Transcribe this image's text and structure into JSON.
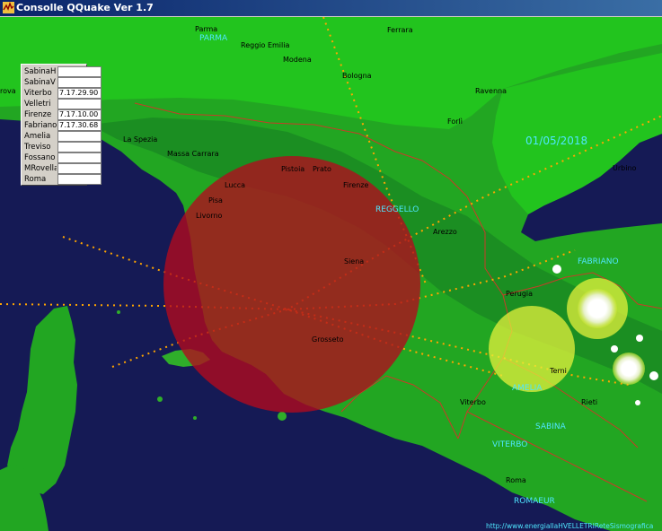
{
  "window": {
    "title": "Consolle QQuake Ver 1.7",
    "title_icon": "qquake-app-icon"
  },
  "map": {
    "date": "01/05/2018",
    "url_text": "http://www.energiallaHVELLETRIReteSismografica",
    "cities": [
      {
        "name": "Parma",
        "style": "black"
      },
      {
        "name": "PARMA",
        "style": "cyan"
      },
      {
        "name": "Reggio Emilia",
        "style": "black"
      },
      {
        "name": "Modena",
        "style": "black"
      },
      {
        "name": "Ferrara",
        "style": "black"
      },
      {
        "name": "Bologna",
        "style": "black"
      },
      {
        "name": "Ravenna",
        "style": "black"
      },
      {
        "name": "Forlì",
        "style": "black"
      },
      {
        "name": "La Spezia",
        "style": "black"
      },
      {
        "name": "Massa Carrara",
        "style": "black"
      },
      {
        "name": "Pistoia",
        "style": "black"
      },
      {
        "name": "Prato",
        "style": "black"
      },
      {
        "name": "Lucca",
        "style": "black"
      },
      {
        "name": "Firenze",
        "style": "black"
      },
      {
        "name": "Pisa",
        "style": "black"
      },
      {
        "name": "Livorno",
        "style": "black"
      },
      {
        "name": "REGGELLO",
        "style": "cyan"
      },
      {
        "name": "Arezzo",
        "style": "black"
      },
      {
        "name": "Siena",
        "style": "black"
      },
      {
        "name": "Grosseto",
        "style": "black"
      },
      {
        "name": "Perugia",
        "style": "black"
      },
      {
        "name": "Urbino",
        "style": "black"
      },
      {
        "name": "FABRIANO",
        "style": "cyan"
      },
      {
        "name": "Terni",
        "style": "black"
      },
      {
        "name": "AMELIA",
        "style": "cyan"
      },
      {
        "name": "Viterbo",
        "style": "black"
      },
      {
        "name": "Rieti",
        "style": "black"
      },
      {
        "name": "SABINA",
        "style": "cyan"
      },
      {
        "name": "VITERBO",
        "style": "cyan"
      },
      {
        "name": "Roma",
        "style": "black"
      },
      {
        "name": "ROMAEUR",
        "style": "cyan"
      },
      {
        "name": "rova",
        "style": "black"
      }
    ],
    "event_circle_color": "#b40a1e",
    "station_circle_color": "#e6f03c",
    "dotted_line_color": "#ffa500"
  },
  "panel": {
    "rows": [
      {
        "label": "SabinaH",
        "value": ""
      },
      {
        "label": "SabinaV",
        "value": ""
      },
      {
        "label": "Viterbo",
        "value": "7.17.29.90"
      },
      {
        "label": "Velletri",
        "value": ""
      },
      {
        "label": "Firenze",
        "value": "7.17.10.00"
      },
      {
        "label": "Fabriano",
        "value": "7.17.30.68"
      },
      {
        "label": "Amelia",
        "value": ""
      },
      {
        "label": "Treviso",
        "value": ""
      },
      {
        "label": "Fossano",
        "value": ""
      },
      {
        "label": "MRovella",
        "value": ""
      },
      {
        "label": "Roma",
        "value": ""
      }
    ]
  }
}
